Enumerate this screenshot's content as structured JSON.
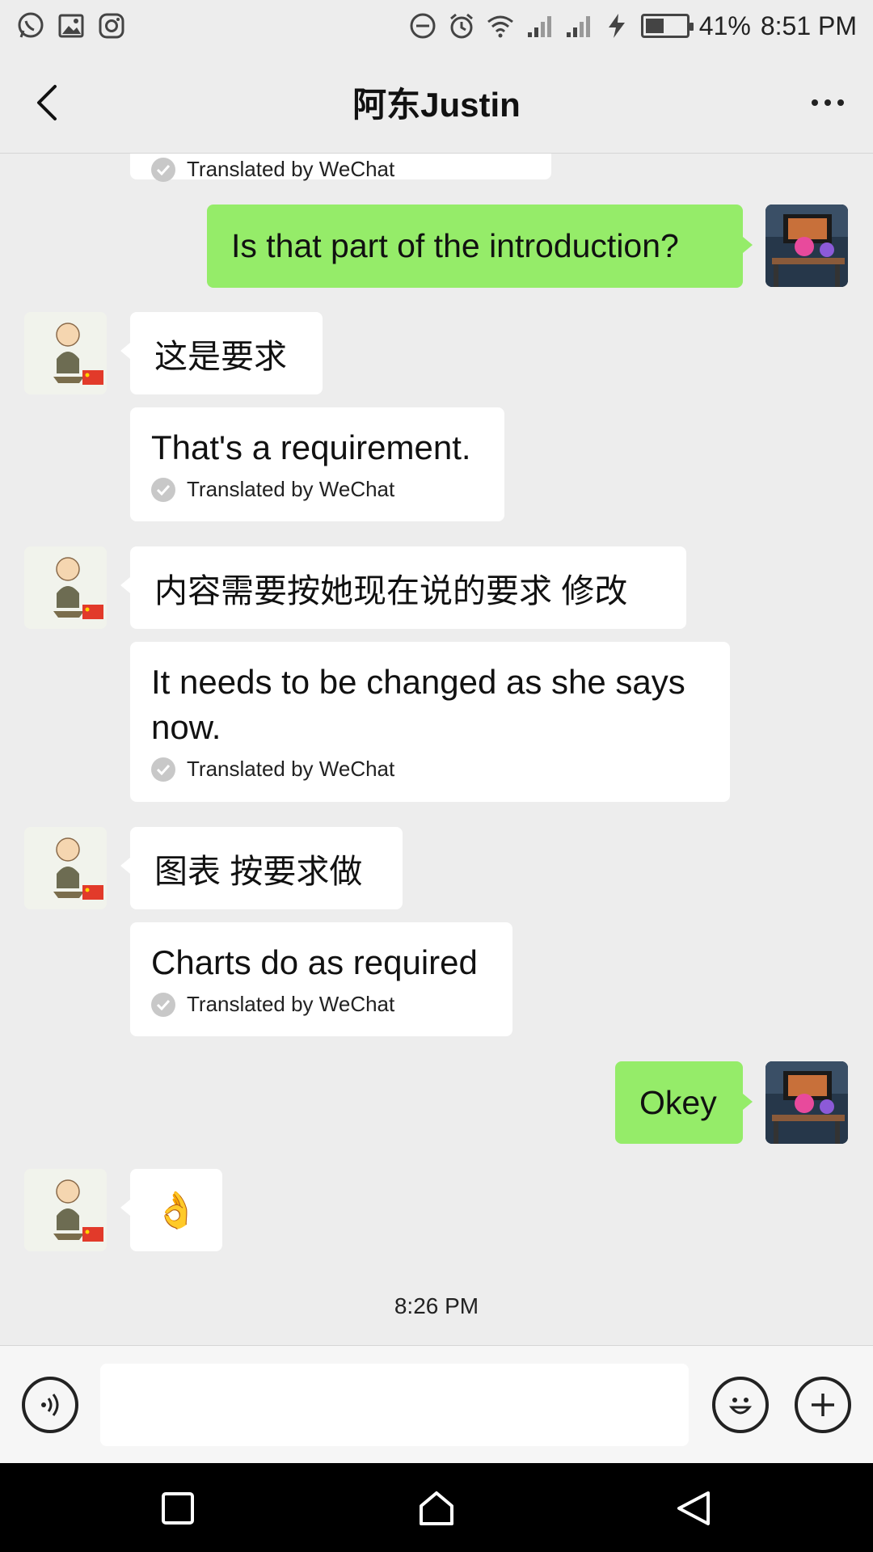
{
  "status_bar": {
    "battery": "41%",
    "battery_level": 0.41,
    "time": "8:51 PM",
    "left_icons": [
      "whatsapp-icon",
      "gallery-icon",
      "instagram-icon"
    ],
    "right_icons": [
      "dnd-icon",
      "alarm-icon",
      "wifi-icon",
      "signal-icon",
      "signal-2-icon",
      "charging-icon",
      "battery-icon"
    ]
  },
  "header": {
    "title": "阿东Justin"
  },
  "messages": [
    {
      "side": "right",
      "text": "Is that part of the introduction?"
    },
    {
      "side": "left",
      "text": "这是要求",
      "translation": "That's a requirement.",
      "translated_by": "Translated by WeChat"
    },
    {
      "side": "left",
      "text": "内容需要按她现在说的要求 修改",
      "translation": "It needs to be changed as she says now.",
      "translated_by": "Translated by WeChat"
    },
    {
      "side": "left",
      "text": "图表 按要求做",
      "translation": "Charts do as required",
      "translated_by": "Translated by WeChat"
    },
    {
      "side": "right",
      "text": "Okey"
    },
    {
      "side": "left",
      "text": "👌"
    }
  ],
  "partial_top": {
    "translated_by": "Translated by WeChat"
  },
  "timestamp": "8:26 PM",
  "input": {
    "value": ""
  },
  "colors": {
    "sent_bubble": "#95ec69",
    "received_bubble": "#ffffff",
    "background": "#ededed"
  }
}
